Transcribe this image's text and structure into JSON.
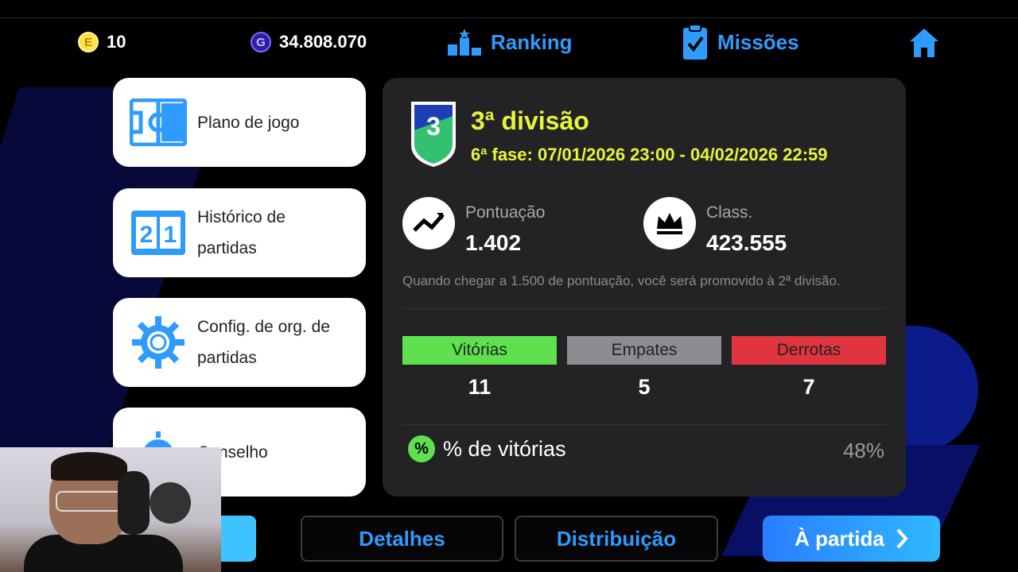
{
  "topbar": {
    "coin_e_value": "10",
    "coin_g_value": "34.808.070",
    "coin_e_symbol": "E",
    "coin_g_symbol": "G",
    "ranking_label": "Ranking",
    "missoes_label": "Missões"
  },
  "menu": {
    "items": [
      {
        "label": "Plano de jogo",
        "icon": "tactics-board-icon"
      },
      {
        "label": "Histórico de\npartidas",
        "icon": "scoreboard-icon"
      },
      {
        "label": "Config. de org. de\npartidas",
        "icon": "gear-icon"
      },
      {
        "label": "Conselho",
        "icon": "lightbulb-icon"
      }
    ]
  },
  "division": {
    "title": "3ª divisão",
    "phase": "6ª fase: 07/01/2026 23:00 - 04/02/2026 22:59",
    "badge_number": "3"
  },
  "stats": {
    "score_label": "Pontuação",
    "score_value": "1.402",
    "rank_label": "Class.",
    "rank_value": "423.555",
    "note": "Quando chegar a 1.500 de pontuação, você será promovido à 2ª divisão."
  },
  "record": {
    "wins_label": "Vitórias",
    "draws_label": "Empates",
    "losses_label": "Derrotas",
    "wins": "11",
    "draws": "5",
    "losses": "7",
    "win_pct_symbol": "%",
    "win_pct_label": "% de vitórias",
    "win_pct_value": "48%"
  },
  "buttons": {
    "details": "Detalhes",
    "distribution": "Distribuição",
    "to_match": "À partida"
  },
  "colors": {
    "accent_blue": "#2f9bff",
    "division_yellow": "#e6f53a",
    "win_green": "#5ee04f",
    "draw_gray": "#8c8c91",
    "loss_red": "#e0343e"
  }
}
